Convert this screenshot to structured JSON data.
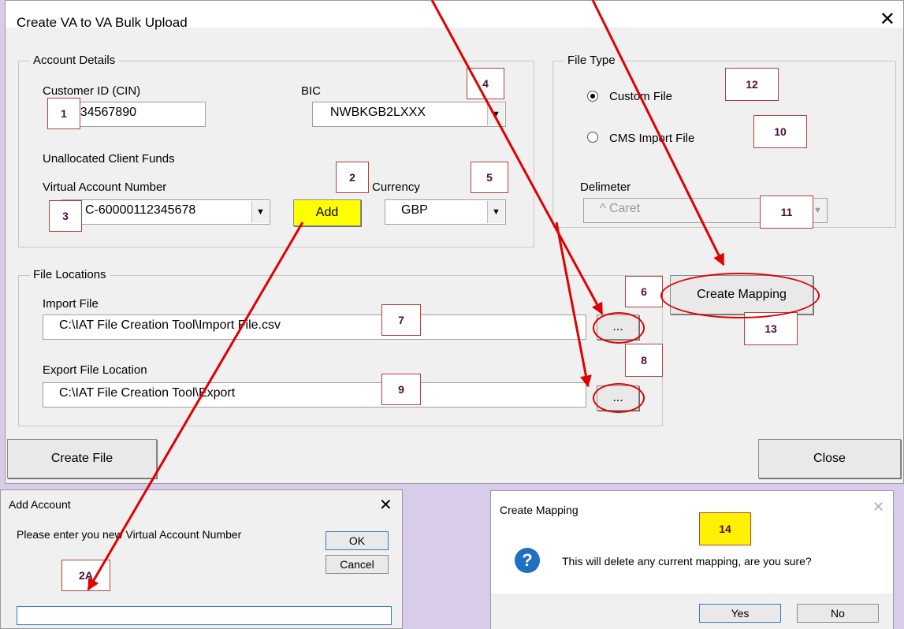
{
  "main_dialog": {
    "title": "Create VA to VA Bulk Upload",
    "account_details": {
      "group_title": "Account Details",
      "customer_id_label": "Customer ID (CIN)",
      "customer_id_value": "1234567890",
      "bic_label": "BIC",
      "bic_value": "NWBKGB2LXXX",
      "unallocated_label": "Unallocated Client Funds",
      "van_label": "Virtual Account Number",
      "van_value": "C-60000112345678",
      "add_label": "Add",
      "currency_label": "Currency",
      "currency_value": "GBP"
    },
    "file_type": {
      "group_title": "File Type",
      "custom_file_label": "Custom File",
      "cms_import_label": "CMS Import File",
      "selected": "Custom File",
      "delimeter_label": "Delimeter",
      "delimeter_value": "^ Caret"
    },
    "file_locations": {
      "group_title": "File Locations",
      "import_label": "Import File",
      "import_value": "C:\\IAT File Creation Tool\\Import File.csv",
      "export_label": "Export File Location",
      "export_value": "C:\\IAT File Creation Tool\\Export",
      "browse_label": "..."
    },
    "create_mapping_label": "Create Mapping",
    "create_file_label": "Create File",
    "close_label": "Close"
  },
  "add_account_dialog": {
    "title": "Add Account",
    "prompt": "Please enter you new Virtual Account Number",
    "ok_label": "OK",
    "cancel_label": "Cancel",
    "input_value": ""
  },
  "create_mapping_dialog": {
    "title": "Create Mapping",
    "message": "This will delete any current mapping, are you sure?",
    "yes_label": "Yes",
    "no_label": "No"
  },
  "callouts": {
    "c1": "1",
    "c2": "2",
    "c2a": "2A",
    "c3": "3",
    "c4": "4",
    "c5": "5",
    "c6": "6",
    "c7": "7",
    "c8": "8",
    "c9": "9",
    "c10": "10",
    "c11": "11",
    "c12": "12",
    "c13": "13",
    "c14": "14"
  },
  "colors": {
    "annotation_red": "#e00000",
    "highlight_yellow": "#ffff00",
    "background_lavender": "#d8ccea"
  }
}
